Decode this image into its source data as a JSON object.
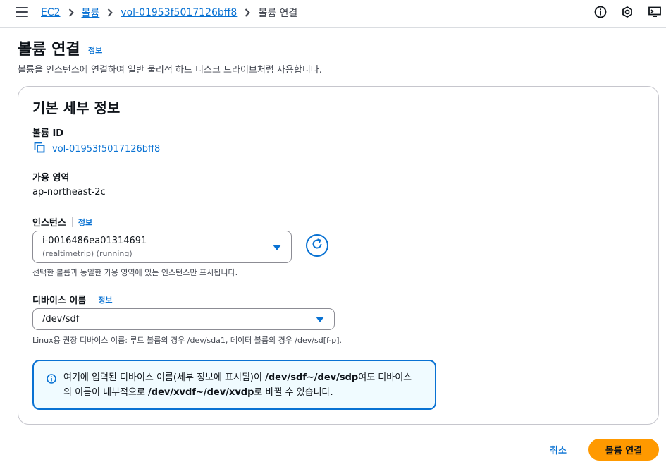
{
  "breadcrumb": {
    "items": [
      "EC2",
      "볼륨",
      "vol-01953f5017126bff8"
    ],
    "current": "볼륨 연결"
  },
  "header": {
    "title": "볼륨 연결",
    "info": "정보",
    "description": "볼륨을 인스턴스에 연결하여 일반 물리적 하드 디스크 드라이브처럼 사용합니다."
  },
  "details": {
    "section_title": "기본 세부 정보",
    "volume_id_label": "볼륨 ID",
    "volume_id": "vol-01953f5017126bff8",
    "az_label": "가용 영역",
    "az_value": "ap-northeast-2c",
    "instance_label": "인스턴스",
    "instance_info": "정보",
    "instance_value": "i-0016486ea01314691",
    "instance_sub": "(realtimetrip) (running)",
    "instance_hint": "선택한 볼륨과 동일한 가용 영역에 있는 인스턴스만 표시됩니다.",
    "device_label": "디바이스 이름",
    "device_info": "정보",
    "device_value": "/dev/sdf",
    "device_hint": "Linux용 권장 디바이스 이름: 루트 볼륨의 경우 /dev/sda1, 데이터 볼륨의 경우 /dev/sd[f-p]."
  },
  "alert": {
    "t1": "여기에 입력된 디바이스 이름(세부 정보에 표시됨)이 ",
    "b1": "/dev/sdf~/dev/sdp",
    "t2": "여도 디바이스",
    "t3": "의 이름이 내부적으로 ",
    "b2": "/dev/xvdf~/dev/xvdp",
    "t4": "로 바뀔 수 있습니다."
  },
  "actions": {
    "cancel": "취소",
    "submit": "볼륨 연결"
  },
  "icons": {
    "menu": "hamburger-icon",
    "info": "info-circle-icon",
    "notifications": "hexagon-icon",
    "cloudshell": "monitor-icon",
    "copy": "copy-icon",
    "refresh": "refresh-icon",
    "caret": "caret-down-icon"
  },
  "colors": {
    "link": "#0972d3",
    "primary": "#ff9900",
    "alert_bg": "#f0fbff"
  }
}
